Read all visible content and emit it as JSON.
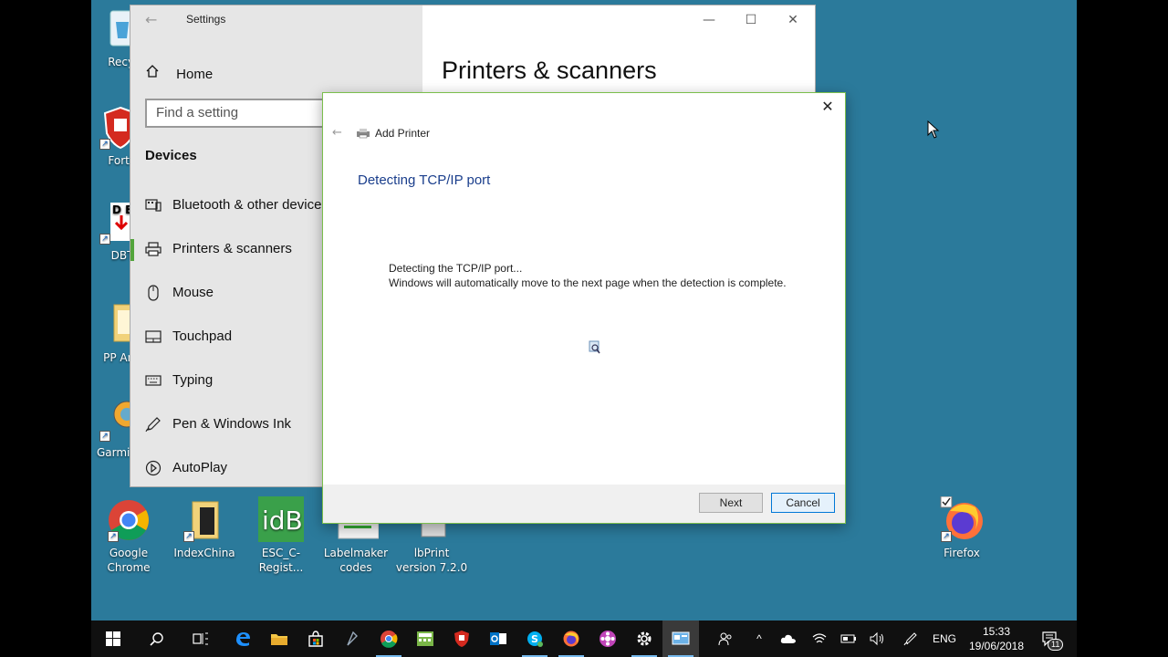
{
  "desktop": {
    "icons": [
      {
        "label": "Recyc"
      },
      {
        "label": "FortiC"
      },
      {
        "label": "DBT"
      },
      {
        "label": "PP Ann"
      },
      {
        "label": "Garmin"
      },
      {
        "label": "Google Chrome"
      },
      {
        "label": "IndexChina"
      },
      {
        "label": "ESC_C-Regist..."
      },
      {
        "label": "Labelmaker codes"
      },
      {
        "label": "lbPrint version 7.2.0"
      },
      {
        "label": "Firefox"
      }
    ]
  },
  "settings": {
    "title": "Settings",
    "home": "Home",
    "search_placeholder": "Find a setting",
    "section": "Devices",
    "nav": [
      {
        "label": "Bluetooth & other devices",
        "icon": "bluetooth-devices-icon"
      },
      {
        "label": "Printers & scanners",
        "icon": "printer-icon"
      },
      {
        "label": "Mouse",
        "icon": "mouse-icon"
      },
      {
        "label": "Touchpad",
        "icon": "touchpad-icon"
      },
      {
        "label": "Typing",
        "icon": "keyboard-icon"
      },
      {
        "label": "Pen & Windows Ink",
        "icon": "pen-icon"
      },
      {
        "label": "AutoPlay",
        "icon": "autoplay-icon"
      }
    ],
    "page_heading": "Printers & scanners"
  },
  "dialog": {
    "title": "Add Printer",
    "heading": "Detecting TCP/IP port",
    "message_line1": "Detecting the TCP/IP port...",
    "message_line2": "Windows will automatically move to the next page when the detection is complete.",
    "next_label": "Next",
    "cancel_label": "Cancel"
  },
  "taskbar": {
    "lang": "ENG",
    "time": "15:33",
    "date": "19/06/2018",
    "notification_count": "11"
  }
}
